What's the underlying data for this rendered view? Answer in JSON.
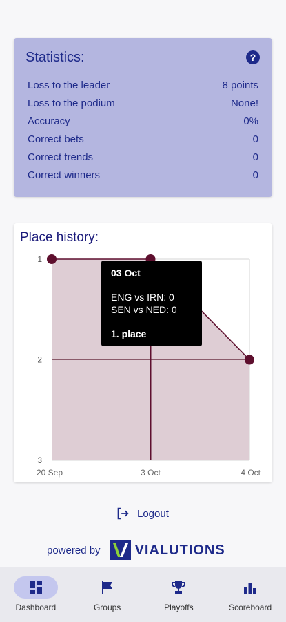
{
  "stats": {
    "title": "Statistics:",
    "help_glyph": "?",
    "rows": [
      {
        "label": "Loss to the leader",
        "value": "8 points"
      },
      {
        "label": "Loss to the podium",
        "value": "None!"
      },
      {
        "label": "Accuracy",
        "value": "0%"
      },
      {
        "label": "Correct bets",
        "value": "0"
      },
      {
        "label": "Correct trends",
        "value": "0"
      },
      {
        "label": "Correct winners",
        "value": "0"
      }
    ]
  },
  "history": {
    "title": "Place history:"
  },
  "chart_data": {
    "type": "area",
    "categories": [
      "20 Sep",
      "3 Oct",
      "4 Oct"
    ],
    "values": [
      1,
      1,
      2
    ],
    "yticks": [
      "1",
      "2",
      "3"
    ],
    "ylim": [
      1,
      3
    ],
    "y_inverted": true,
    "grid": true,
    "colors": {
      "line": "#5e0f2e",
      "fill": "#decdd4",
      "cursor": "#5e0f2e"
    }
  },
  "tooltip": {
    "date": "03 Oct",
    "lines": [
      "ENG vs IRN: 0",
      "SEN vs NED: 0"
    ],
    "place": "1. place"
  },
  "logout": {
    "label": "Logout"
  },
  "footer": {
    "powered_by": "powered by",
    "brand": "VIALUTIONS"
  },
  "nav": {
    "items": [
      {
        "label": "Dashboard",
        "icon": "dashboard-icon"
      },
      {
        "label": "Groups",
        "icon": "flag-icon"
      },
      {
        "label": "Playoffs",
        "icon": "trophy-icon"
      },
      {
        "label": "Scoreboard",
        "icon": "leaderboard-icon"
      }
    ]
  },
  "colors": {
    "accent": "#1e2a8a",
    "card": "#b4b6e0",
    "nav_active": "#c4c7ee"
  }
}
